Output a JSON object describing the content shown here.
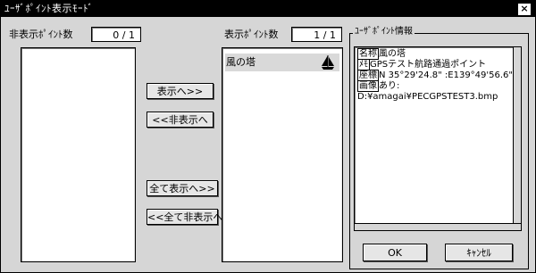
{
  "window": {
    "title": "ﾕｰｻﾞﾎﾟｲﾝﾄ表示ﾓｰﾄﾞ",
    "close_glyph": "×"
  },
  "hidden_list": {
    "label": "非表示ﾎﾟｲﾝﾄ数",
    "count": "0 / 1",
    "items": []
  },
  "shown_list": {
    "label": "表示ﾎﾟｲﾝﾄ数",
    "count": "1 / 1",
    "items": [
      {
        "label": "風の塔",
        "icon": "sailboat-icon"
      }
    ]
  },
  "transfer_buttons": {
    "show": "表示へ>>",
    "hide": "<<非表示へ",
    "show_all": "全て表示へ>>",
    "hide_all": "<<全て非表示へ"
  },
  "info_panel": {
    "label": "ﾕｰｻﾞﾎﾟｲﾝﾄ情報",
    "lines": [
      {
        "tag": "名称",
        "text": "風の塔"
      },
      {
        "tag": "ﾒﾓ",
        "text": "GPSテスト航路通過ポイント"
      },
      {
        "tag": "座標",
        "text": "N 35°29'24.8\" :E139°49'56.6\""
      },
      {
        "tag": "画像",
        "text": "あり:"
      },
      {
        "tag": "",
        "text": "D:¥amagai¥PECGPSTEST3.bmp"
      }
    ]
  },
  "dialog_buttons": {
    "ok": "OK",
    "cancel": "ｷｬﾝｾﾙ"
  }
}
